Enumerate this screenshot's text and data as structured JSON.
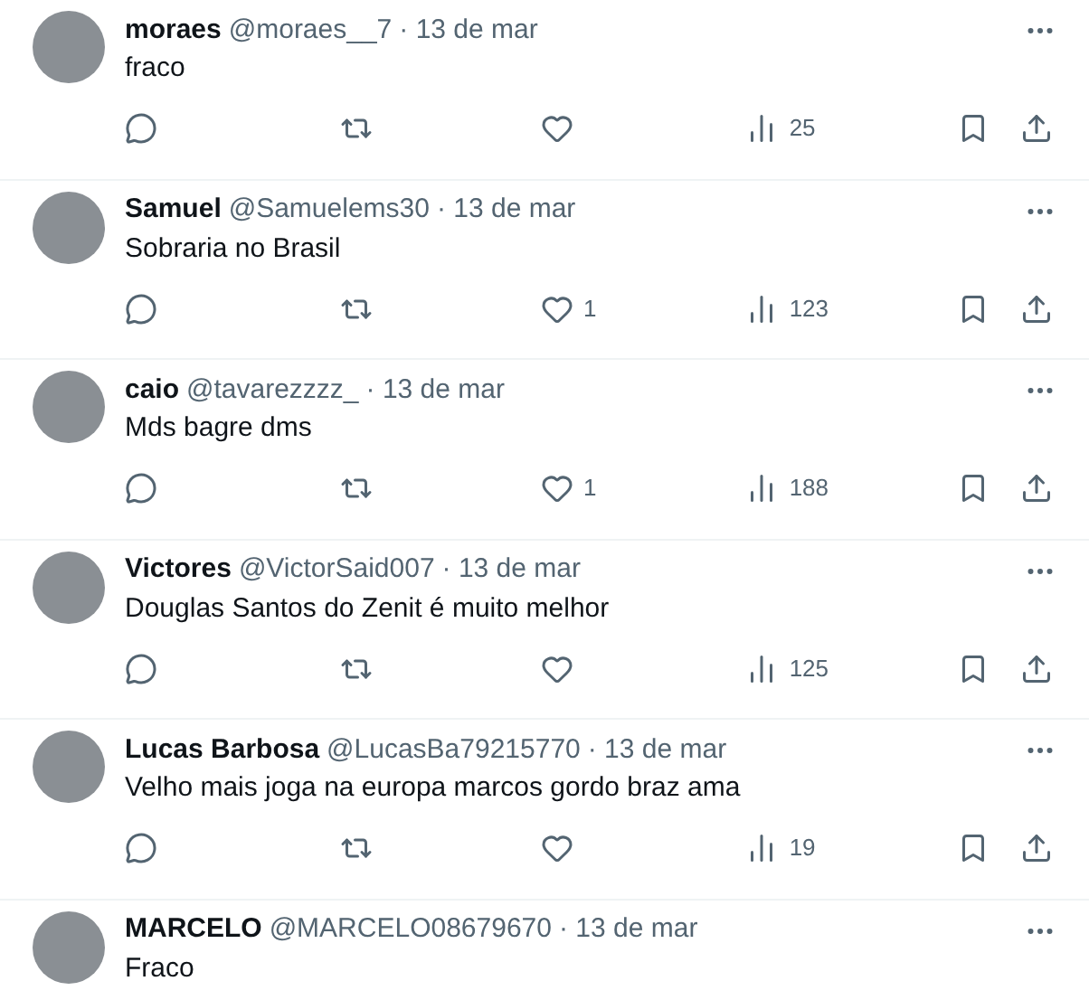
{
  "replies": [
    {
      "name": "moraes",
      "handle": "@moraes__7",
      "date": "· 13 de mar",
      "text": "fraco",
      "views": "25"
    },
    {
      "name": "Samuel",
      "handle": "@Samuelems30",
      "date": "· 13 de mar",
      "text": "Sobraria no Brasil",
      "likes": "1",
      "views": "123"
    },
    {
      "name": "caio",
      "handle": "@tavarezzzz_",
      "date": "· 13 de mar",
      "text": "Mds bagre dms",
      "likes": "1",
      "views": "188"
    },
    {
      "name": "Victores",
      "handle": "@VictorSaid007",
      "date": "· 13 de mar",
      "text": "Douglas Santos do Zenit é muito melhor",
      "views": "125"
    },
    {
      "name": "Lucas Barbosa",
      "handle": "@LucasBa79215770",
      "date": "· 13 de mar",
      "text": "Velho mais joga na europa marcos gordo braz ama",
      "views": "19"
    },
    {
      "name": "MARCELO",
      "handle": "@MARCELO08679670",
      "date": "· 13 de mar",
      "text": "Fraco"
    }
  ]
}
